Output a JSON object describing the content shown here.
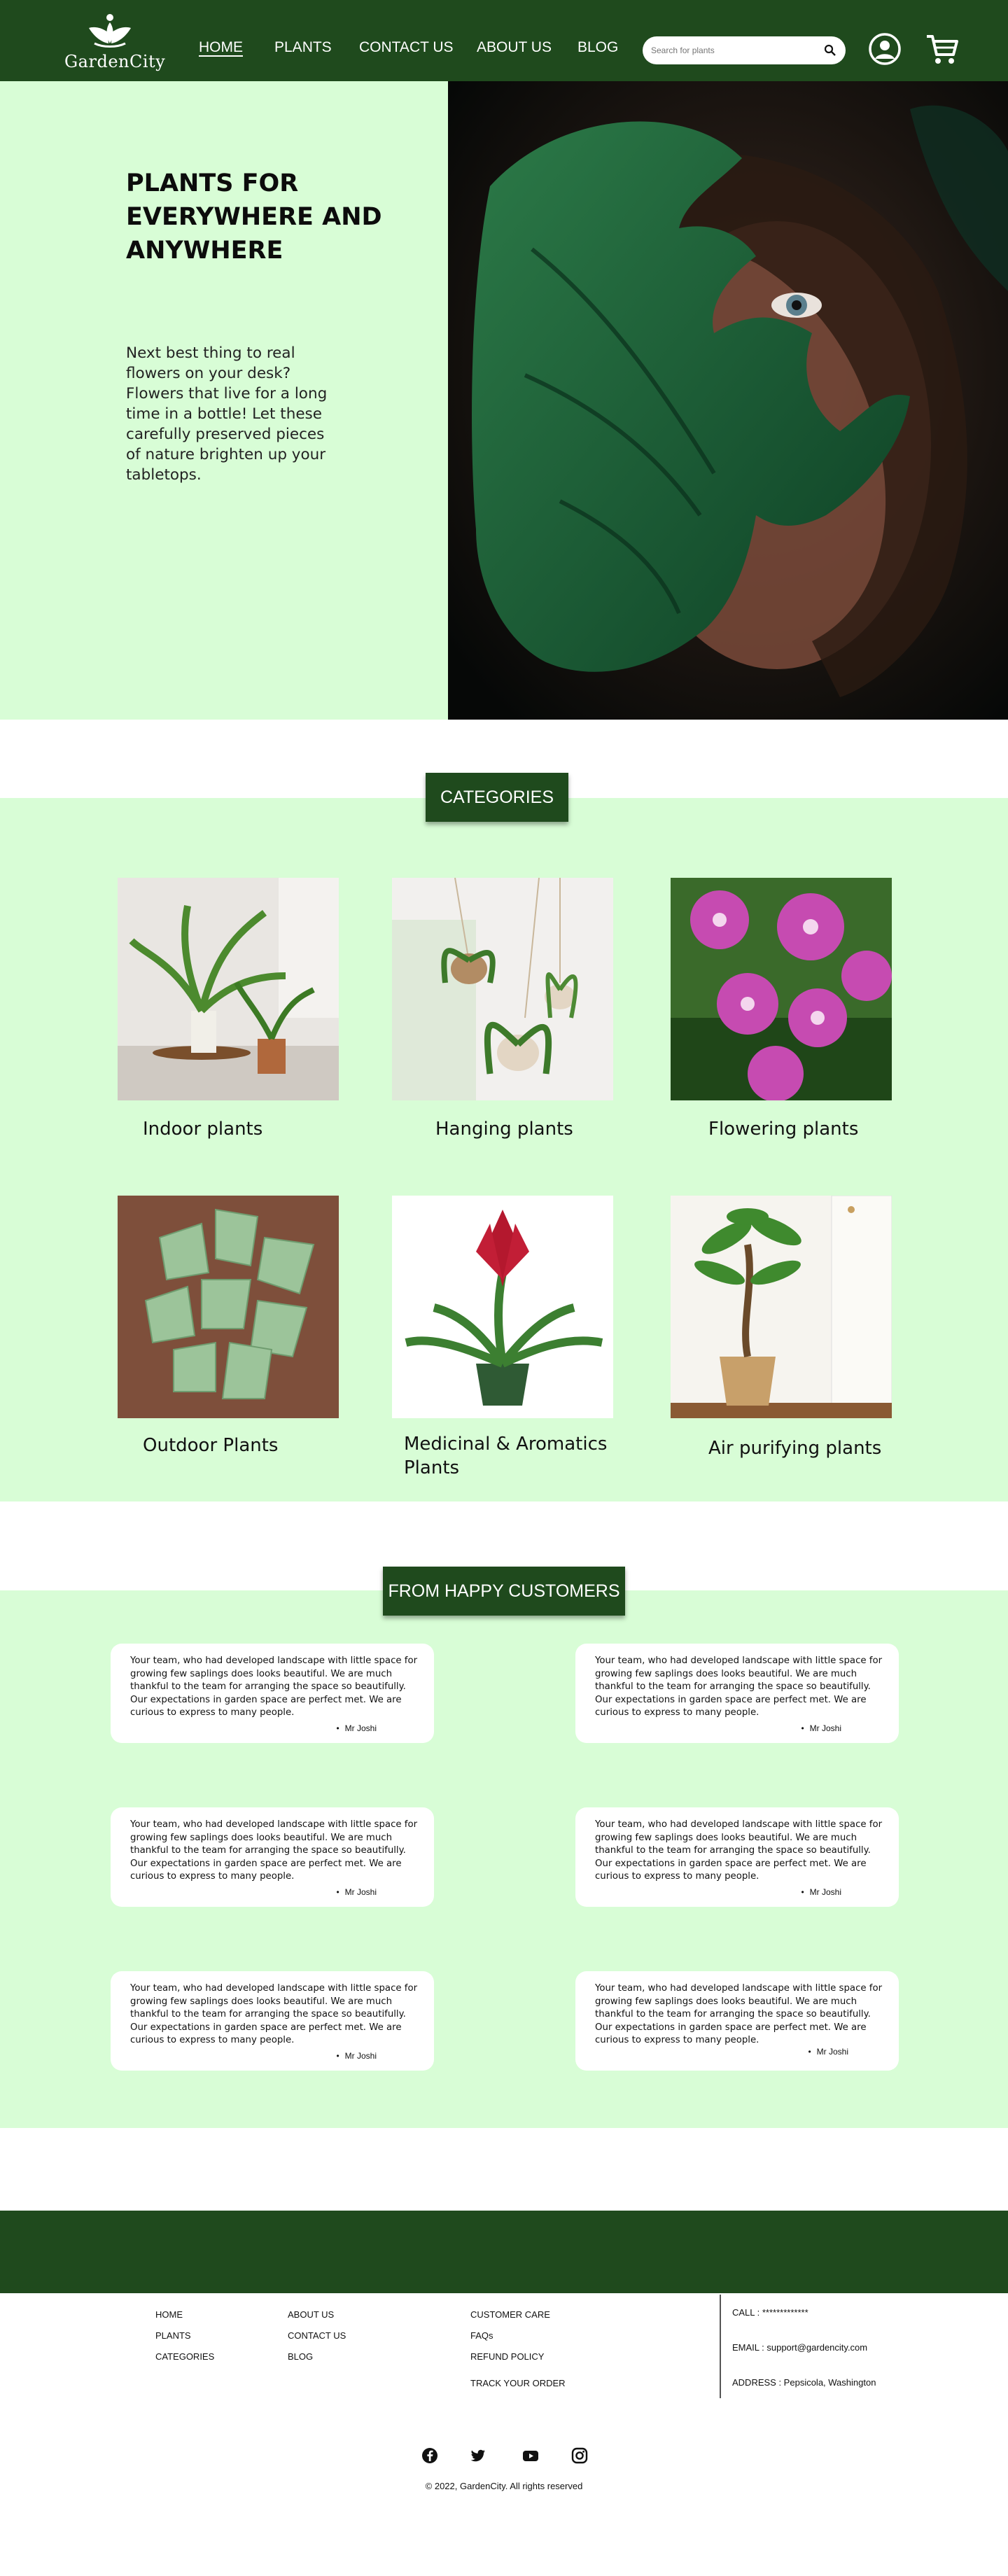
{
  "brand": {
    "name": "GardenCity"
  },
  "nav": {
    "items": [
      {
        "label": "HOME",
        "active": true
      },
      {
        "label": "PLANTS"
      },
      {
        "label": "CONTACT US"
      },
      {
        "label": "ABOUT US"
      },
      {
        "label": "BLOG"
      }
    ],
    "search_placeholder": "Search for plants",
    "icons": [
      "search-icon",
      "account-icon",
      "cart-icon"
    ]
  },
  "hero": {
    "title": "PLANTS FOR EVERYWHERE AND ANYWHERE",
    "subtitle": "Next best thing to real flowers on your desk? Flowers that live for a long time in a bottle! Let these carefully preserved pieces of nature brighten up your tabletops."
  },
  "categories": {
    "heading": "CATEGORIES",
    "items": [
      {
        "label": "Indoor plants"
      },
      {
        "label": "Hanging plants"
      },
      {
        "label": "Flowering plants"
      },
      {
        "label": "Outdoor Plants"
      },
      {
        "label": "Medicinal & Aromatics Plants"
      },
      {
        "label": "Air purifying plants"
      }
    ]
  },
  "testimonials": {
    "heading": "FROM HAPPY CUSTOMERS",
    "items": [
      {
        "text": "Your team, who had developed landscape with little space for growing few saplings does looks beautiful. We are much thankful to the team for arranging the space so beautifully. Our expectations in garden space are perfect met. We are curious to express to many people.",
        "author": "Mr Joshi"
      },
      {
        "text": "Your team, who had developed landscape with little space for growing few saplings does looks beautiful. We are much thankful to the team for arranging the space so beautifully. Our expectations in garden space are perfect met. We are curious to express to many people.",
        "author": "Mr Joshi"
      },
      {
        "text": "Your team, who had developed landscape with little space for growing few saplings does looks beautiful. We are much thankful to the team for arranging the space so beautifully. Our expectations in garden space are perfect met. We are curious to express to many people.",
        "author": "Mr Joshi"
      },
      {
        "text": "Your team, who had developed landscape with little space for growing few saplings does looks beautiful. We are much thankful to the team for arranging the space so beautifully. Our expectations in garden space are perfect met. We are curious to express to many people.",
        "author": "Mr Joshi"
      },
      {
        "text": "Your team, who had developed landscape with little space for growing few saplings does looks beautiful. We are much thankful to the team for arranging the space so beautifully. Our expectations in garden space are perfect met. We are curious to express to many people.",
        "author": "Mr Joshi"
      },
      {
        "text": "Your team, who had developed landscape with little space for growing few saplings does looks beautiful. We are much thankful to the team for arranging the space so beautifully. Our expectations in garden space are perfect met. We are curious to express to many people.",
        "author": "Mr Joshi"
      }
    ]
  },
  "footer": {
    "col1": [
      "HOME",
      "PLANTS",
      "CATEGORIES"
    ],
    "col2": [
      "ABOUT US",
      "CONTACT US",
      "BLOG"
    ],
    "col3": [
      "CUSTOMER CARE",
      "FAQs",
      "REFUND POLICY",
      "TRACK YOUR ORDER"
    ],
    "contact": {
      "call": "CALL : *************",
      "email": "EMAIL : support@gardencity.com",
      "address": "ADDRESS : Pepsicola, Washington"
    },
    "social": [
      "facebook-icon",
      "twitter-icon",
      "youtube-icon",
      "instagram-icon"
    ],
    "copyright": "© 2022, GardenCity. All rights reserved"
  },
  "colors": {
    "primary": "#1f4a1d",
    "light": "#d8fdd6",
    "white": "#ffffff"
  }
}
